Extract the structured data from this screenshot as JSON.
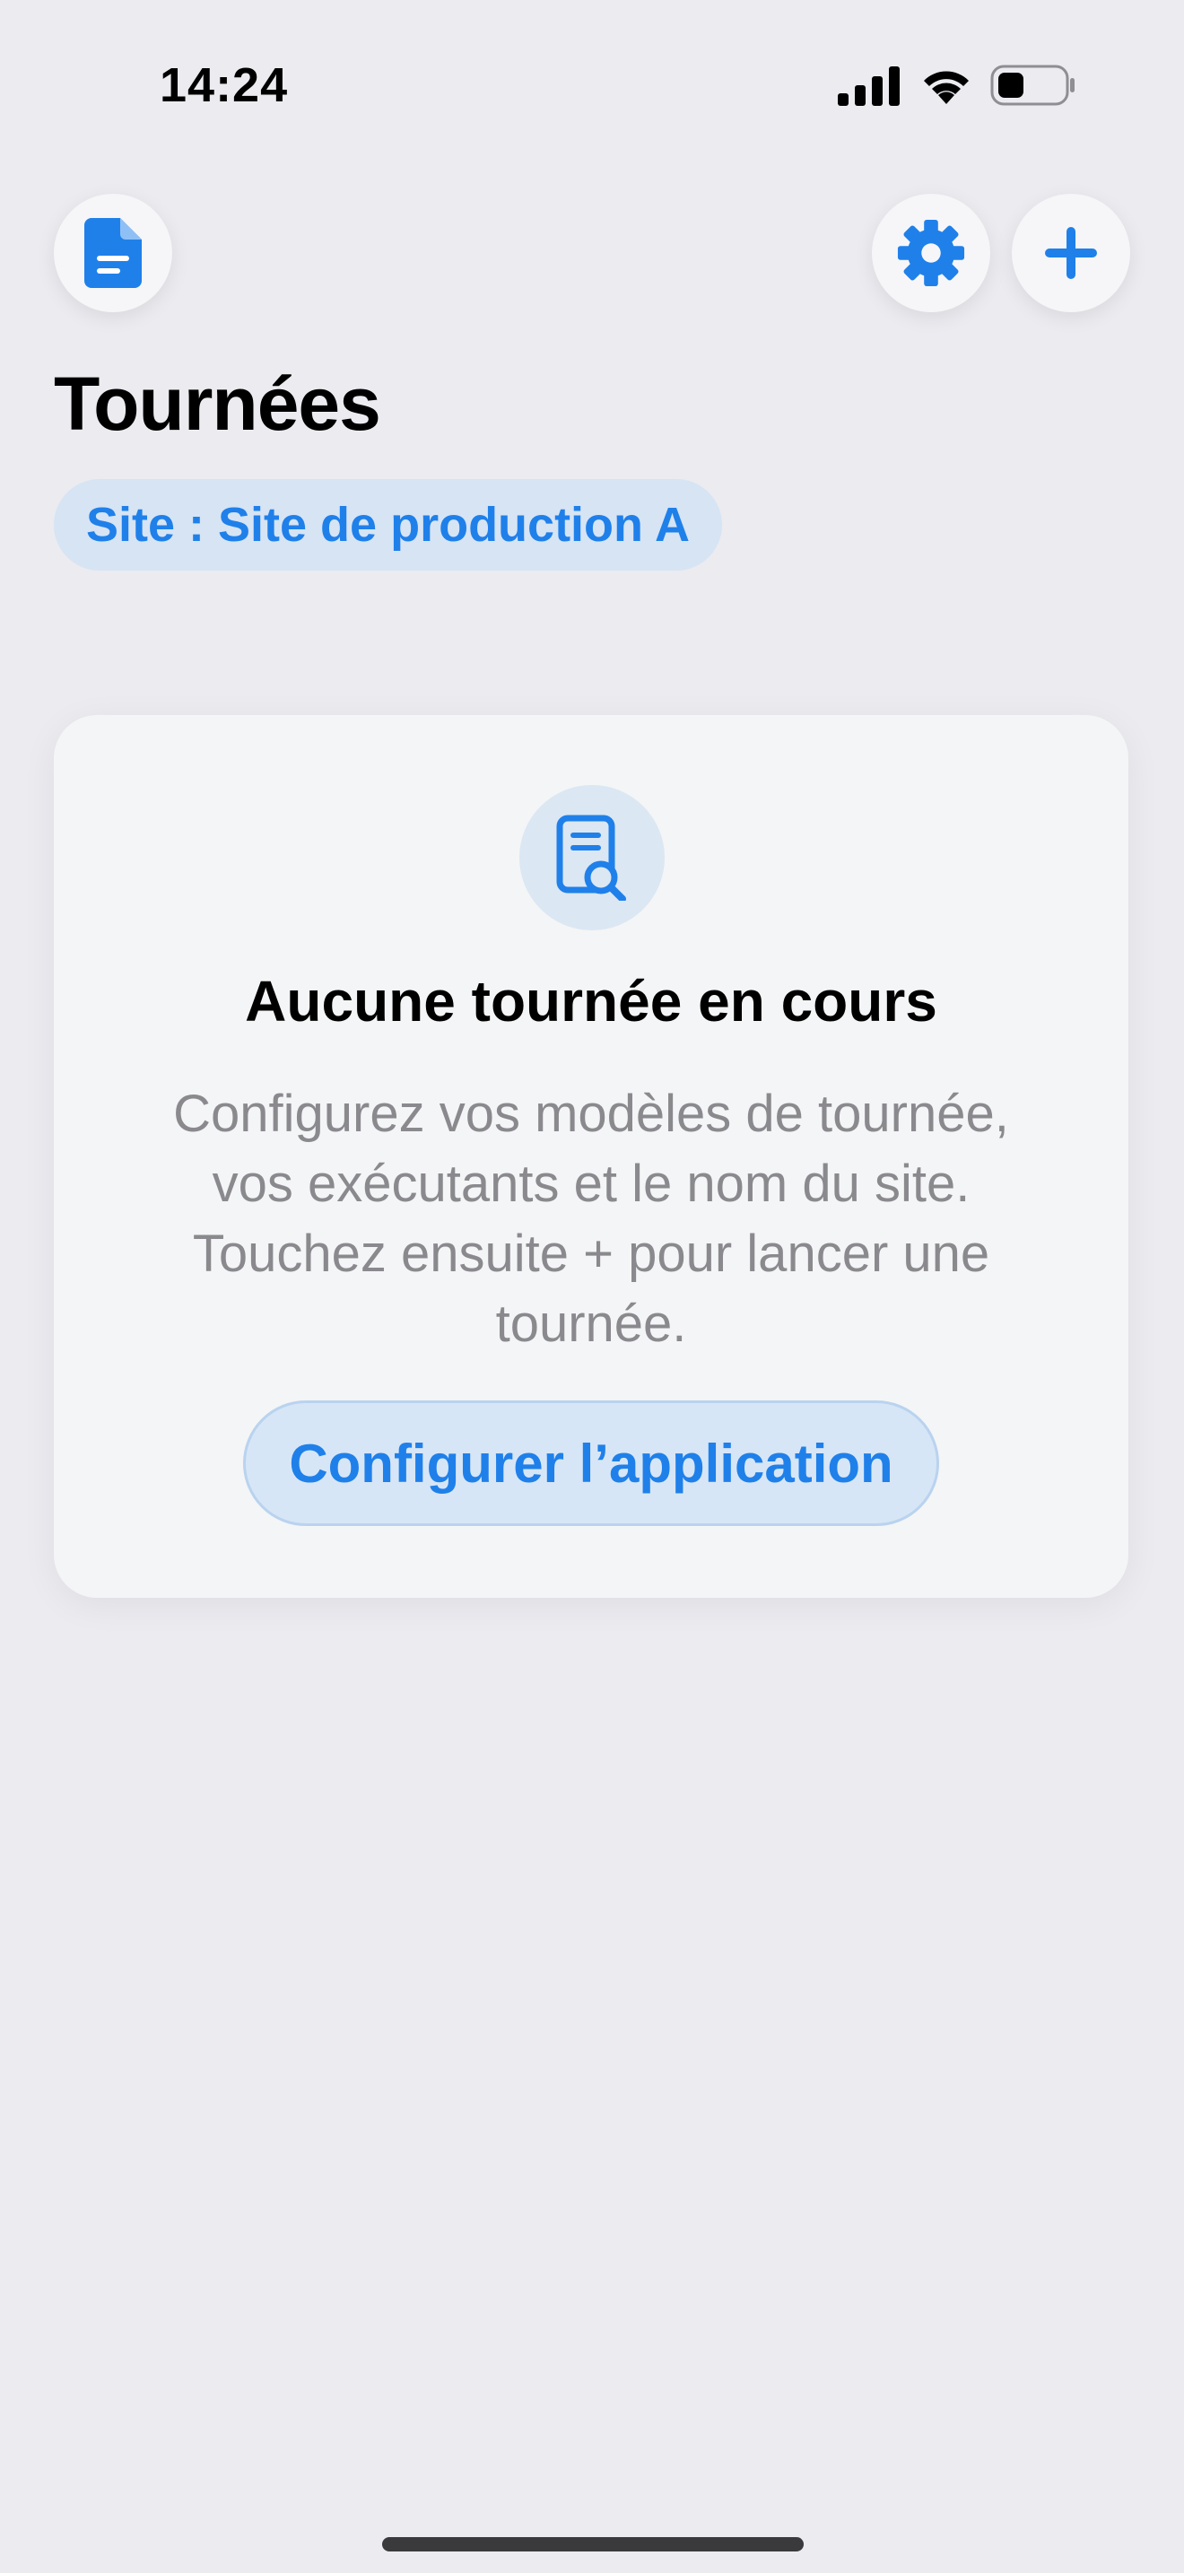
{
  "status_bar": {
    "time": "14:24",
    "signal_icon": "cellular-signal-icon",
    "wifi_icon": "wifi-icon",
    "battery_icon": "battery-icon",
    "battery_level": 0.35
  },
  "toolbar": {
    "left_icon": "document-icon",
    "settings_icon": "gear-icon",
    "add_icon": "plus-icon"
  },
  "header": {
    "title": "Tournées",
    "site_chip_label": "Site : Site de production A"
  },
  "empty_state": {
    "icon": "document-search-icon",
    "title": "Aucune tournée en cours",
    "description": "Configurez vos modèles de tournée, vos exécutants et le nom du site. Touchez ensuite + pour lancer une tournée.",
    "button_label": "Configurer l’application"
  },
  "colors": {
    "accent": "#1f80ea",
    "background": "#ebebf0",
    "card": "#f4f5f6",
    "chip_background": "#d6e4f4",
    "secondary_text": "#8a8a8e"
  }
}
